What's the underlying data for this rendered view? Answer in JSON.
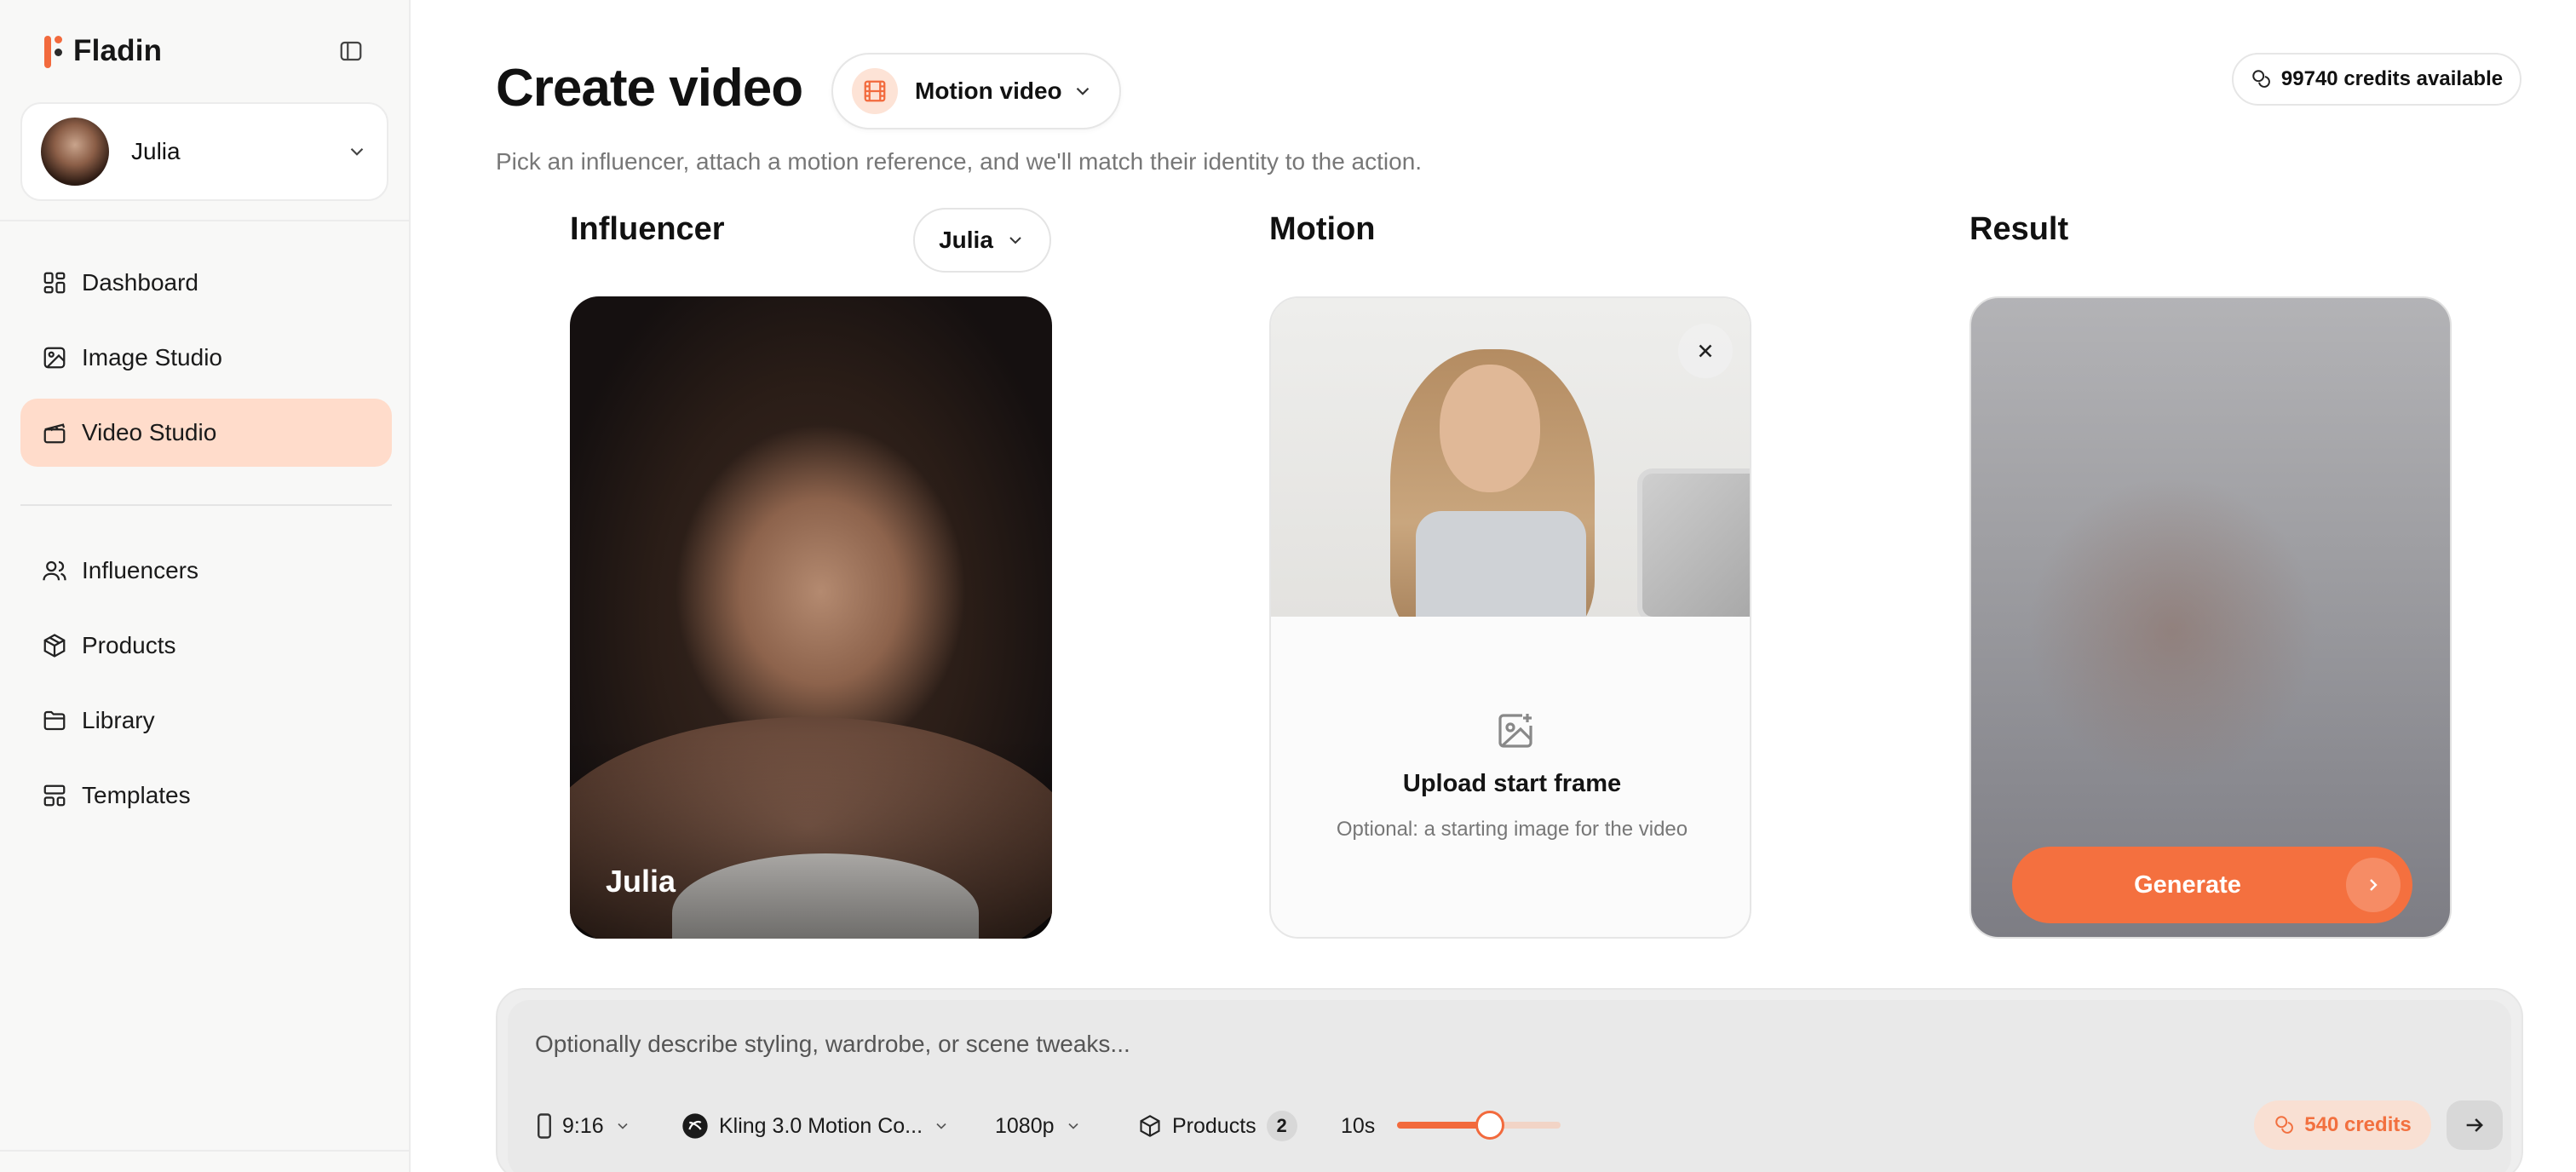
{
  "app": {
    "name": "Fladin",
    "accent": "#f26a3d"
  },
  "sidebar": {
    "user": {
      "name": "Julia"
    },
    "nav_main": [
      {
        "label": "Dashboard",
        "icon": "dashboard-icon"
      },
      {
        "label": "Image Studio",
        "icon": "image-icon"
      },
      {
        "label": "Video Studio",
        "icon": "video-icon",
        "active": true
      }
    ],
    "nav_secondary": [
      {
        "label": "Influencers",
        "icon": "users-icon"
      },
      {
        "label": "Products",
        "icon": "box-icon"
      },
      {
        "label": "Library",
        "icon": "folder-icon"
      },
      {
        "label": "Templates",
        "icon": "templates-icon"
      }
    ]
  },
  "header": {
    "title": "Create video",
    "mode": "Motion video",
    "credits": "99740 credits available",
    "subtitle": "Pick an influencer, attach a motion reference, and we'll match their identity to the action."
  },
  "columns": {
    "influencer": {
      "title": "Influencer",
      "selected": "Julia",
      "card_name": "Julia"
    },
    "motion": {
      "title": "Motion",
      "upload_title": "Upload start frame",
      "upload_sub": "Optional: a starting image for the video"
    },
    "result": {
      "title": "Result",
      "generate_label": "Generate"
    }
  },
  "prompt": {
    "placeholder": "Optionally describe styling, wardrobe, or scene tweaks...",
    "aspect": "9:16",
    "model": "Kling 3.0 Motion Co...",
    "resolution": "1080p",
    "products_label": "Products",
    "products_count": "2",
    "duration": "10s",
    "duration_fraction": 0.57,
    "cost": "540 credits"
  }
}
